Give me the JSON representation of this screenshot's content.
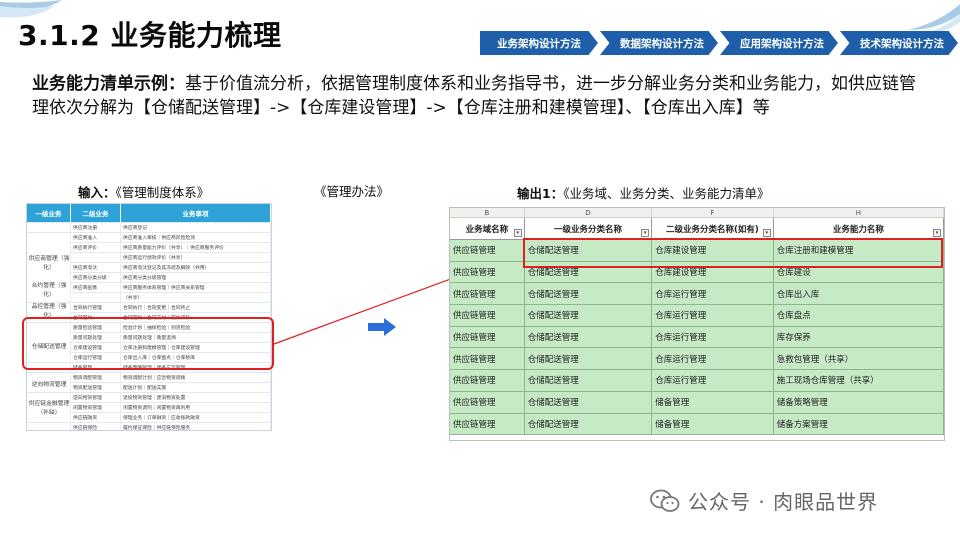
{
  "title": "3.1.2 业务能力梳理",
  "nav": [
    "业务架构设计方法",
    "数据架构设计方法",
    "应用架构设计方法",
    "技术架构设计方法"
  ],
  "intro": {
    "lead": "业务能力清单示例：",
    "text": "基于价值流分析，依据管理制度体系和业务指导书，进一步分解业务分类和业务能力，如供应链管理依次分解为【仓储配送管理】->【仓库建设管理】->【仓库注册和建模管理】、【仓库出入库】等"
  },
  "input_caption": {
    "lead": "输入：",
    "text": "《管理制度体系》"
  },
  "method_caption": "《管理办法》",
  "output_caption": {
    "lead": "输出1：",
    "text": "《业务域、业务分类、业务能力清单》"
  },
  "mini_table": {
    "headers": [
      "一级业务",
      "二级业务",
      "业务事项"
    ],
    "groups": [
      {
        "label": "供应商管理（强化）"
      },
      {
        "label": "合约管理（强化）"
      },
      {
        "label": "品控管理（强化）"
      },
      {
        "label": "仓储配送管理"
      },
      {
        "label": "逆向物流管理"
      },
      {
        "label": "供应链金融管理（补缺）"
      }
    ],
    "rows": [
      [
        "",
        "供应商注册",
        "供应商登记"
      ],
      [
        "",
        "供应商准入",
        "供应商准入审核｜供应商风险检测"
      ],
      [
        "",
        "供应商评价",
        "供应商质量能力评价（共享）｜供应商服务评价"
      ],
      [
        "",
        "",
        "供应商运行绩效评价（共享）"
      ],
      [
        "",
        "供应商淘汰",
        "供应商淘汰登记及其冻结及解除（共用）"
      ],
      [
        "",
        "供应商分类分级",
        "供应商分类分级管理"
      ],
      [
        "",
        "供应商画像",
        "供应商服务体系管理｜供应商关系管理"
      ],
      [
        "",
        "",
        "（共享）"
      ],
      [
        "",
        "合同执行管理",
        "合同执行｜合同变更｜合同终止"
      ],
      [
        "",
        "合同履约",
        "合同履约｜合同支付｜履约评价"
      ],
      [
        "",
        "质量检验管理",
        "检验计划｜抽样检验｜到货检验"
      ],
      [
        "",
        "质量问题处理",
        "质量问题处理｜质量追溯"
      ],
      [
        "",
        "仓库建设管理",
        "仓库注册和建模管理｜仓库建设管理"
      ],
      [
        "",
        "仓库运行管理",
        "仓库出入库｜仓库盘点｜仓库移库"
      ],
      [
        "",
        "储备管理",
        "储备策略管理｜储备方案管理"
      ],
      [
        "",
        "物资调配管理",
        "物资调配计划｜应急物资调拨"
      ],
      [
        "",
        "物资配送管理",
        "配送计划｜配送实施"
      ],
      [
        "",
        "逆向物资管理",
        "退役物资管理｜废旧物资处置"
      ],
      [
        "",
        "闲置物资管理",
        "闲置物资调剂｜闲置物资再利用"
      ],
      [
        "",
        "供应链融资",
        "保理业务｜订单融资｜应收账款融资"
      ],
      [
        "",
        "供应链保险",
        "履约保证保险｜供应链保险服务"
      ]
    ]
  },
  "excel": {
    "col_letters": [
      "B",
      "D",
      "F",
      "H"
    ],
    "headers": [
      "业务域名称",
      "一级业务分类名称",
      "二级业务分类名称(如有)",
      "业务能力名称"
    ],
    "rows": [
      [
        "供应链管理",
        "仓储配送管理",
        "仓库建设管理",
        "仓库注册和建模管理"
      ],
      [
        "供应链管理",
        "仓储配送管理",
        "仓库建设管理",
        "仓库建设"
      ],
      [
        "供应链管理",
        "仓储配送管理",
        "仓库运行管理",
        "仓库出入库"
      ],
      [
        "供应链管理",
        "仓储配送管理",
        "仓库运行管理",
        "仓库盘点"
      ],
      [
        "供应链管理",
        "仓储配送管理",
        "仓库运行管理",
        "库存保养"
      ],
      [
        "供应链管理",
        "仓储配送管理",
        "仓库运行管理",
        "急救包管理（共享）"
      ],
      [
        "供应链管理",
        "仓储配送管理",
        "仓库运行管理",
        "施工现场仓库管理（共享）"
      ],
      [
        "供应链管理",
        "仓储配送管理",
        "储备管理",
        "储备策略管理"
      ],
      [
        "供应链管理",
        "仓储配送管理",
        "储备管理",
        "储备方案管理"
      ]
    ]
  },
  "watermark": "公众号 · 肉眼品世界",
  "colors": {
    "nav_bg": "#1f5fa9",
    "mini_header": "#2ea3d8",
    "excel_row": "#c6e9c6",
    "highlight": "#e02020",
    "arrow": "#2a6fd6"
  }
}
